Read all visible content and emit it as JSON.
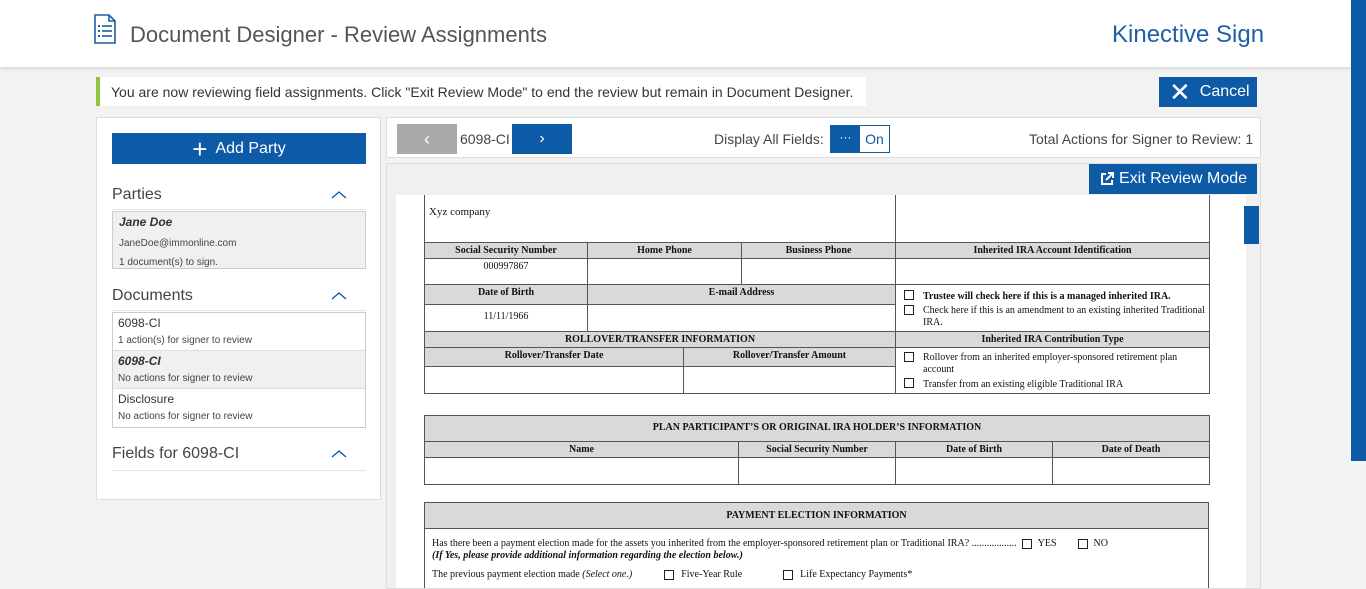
{
  "header": {
    "title": "Document Designer - Review Assignments",
    "brand": "Kinective Sign"
  },
  "notice": "You are now reviewing field assignments. Click \"Exit Review Mode\" to end the review but remain in Document Designer.",
  "cancel_label": "Cancel",
  "sidebar": {
    "add_party_label": "Add Party",
    "parties_title": "Parties",
    "party": {
      "name": "Jane Doe",
      "email": "JaneDoe@immonline.com",
      "docs": "1 document(s) to sign."
    },
    "documents_title": "Documents",
    "documents": [
      {
        "name": "6098-CI",
        "status": "1 action(s) for signer to review"
      },
      {
        "name": "6098-CI",
        "status": "No actions for signer to review"
      },
      {
        "name": "Disclosure",
        "status": "No actions for signer to review"
      }
    ],
    "fields_title": "Fields for 6098-CI"
  },
  "toolbar": {
    "doc_label": "6098-CI",
    "display_all_label": "Display All Fields:",
    "toggle_knob": "···",
    "toggle_on": "On",
    "total_label": "Total Actions for Signer to Review: 1"
  },
  "exit_label": "Exit Review Mode",
  "form": {
    "company": "Xyz company",
    "ssn_h": "Social Security Number",
    "home_h": "Home Phone",
    "business_h": "Business Phone",
    "inherited_h": "Inherited IRA Account Identification",
    "ssn_v": "000997867",
    "dob_h": "Date of Birth",
    "email_h": "E-mail Address",
    "dob_v": "11/11/1966",
    "trustee": "Trustee will check here if this is a managed inherited IRA.",
    "amend": "Check here if this is an amendment to an existing inherited Traditional IRA.",
    "rollover_h": "ROLLOVER/TRANSFER INFORMATION",
    "contrib_h": "Inherited IRA Contribution Type",
    "rdate_h": "Rollover/Transfer Date",
    "ramount_h": "Rollover/Transfer Amount",
    "opt1": "Rollover from an inherited employer-sponsored retirement plan account",
    "opt2": "Transfer from an existing eligible Traditional IRA",
    "plan_h": "PLAN PARTICIPANT’S OR ORIGINAL IRA HOLDER’S INFORMATION",
    "name_h": "Name",
    "ssn2_h": "Social Security Number",
    "dob2_h": "Date of Birth",
    "dod_h": "Date of Death",
    "pay_h": "PAYMENT ELECTION INFORMATION",
    "pay_q": "Has there been a payment election made for the assets you inherited from the employer-sponsored retirement plan or Traditional IRA? ..................",
    "yes": "YES",
    "no": "NO",
    "pay_note": "(If Yes, please provide additional information regarding the election below.)",
    "prev_elect": "The previous payment election made",
    "select_one": "(Select one.)",
    "five_year": "Five-Year Rule",
    "life_exp": "Life Expectancy Payments*"
  }
}
